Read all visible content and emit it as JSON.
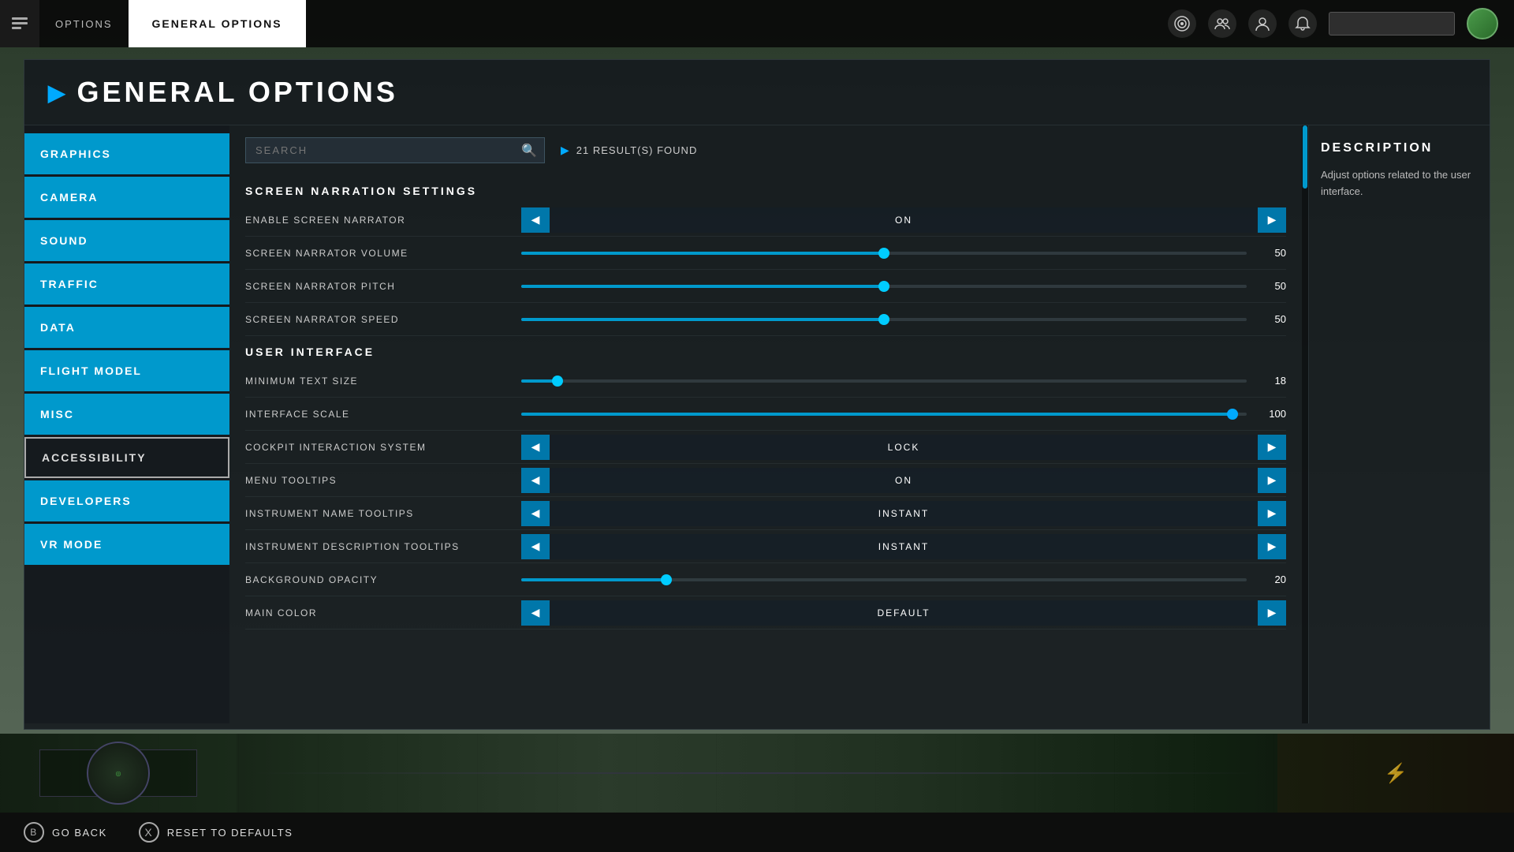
{
  "topbar": {
    "logo_icon": "≡",
    "options_label": "OPTIONS",
    "title_label": "GENERAL OPTIONS",
    "search_placeholder": "",
    "icons": [
      "🎯",
      "👥",
      "👤",
      "🔔"
    ]
  },
  "page": {
    "title": "GENERAL OPTIONS",
    "title_icon": "▶"
  },
  "sidebar": {
    "items": [
      {
        "id": "graphics",
        "label": "GRAPHICS",
        "active": false
      },
      {
        "id": "camera",
        "label": "CAMERA",
        "active": false
      },
      {
        "id": "sound",
        "label": "SOUND",
        "active": false
      },
      {
        "id": "traffic",
        "label": "TRAFFIC",
        "active": false
      },
      {
        "id": "data",
        "label": "DATA",
        "active": false
      },
      {
        "id": "flight-model",
        "label": "FLIGHT MODEL",
        "active": false
      },
      {
        "id": "misc",
        "label": "MISC",
        "active": false
      },
      {
        "id": "accessibility",
        "label": "ACCESSIBILITY",
        "active": true
      },
      {
        "id": "developers",
        "label": "DEVELOPERS",
        "active": false
      },
      {
        "id": "vr-mode",
        "label": "VR MODE",
        "active": false
      }
    ]
  },
  "search": {
    "placeholder": "SEARCH",
    "results_label": "21 RESULT(S) FOUND"
  },
  "sections": [
    {
      "id": "screen-narration",
      "header": "SCREEN NARRATION SETTINGS",
      "settings": [
        {
          "id": "enable-narrator",
          "label": "ENABLE SCREEN NARRATOR",
          "type": "arrow",
          "value": "ON"
        },
        {
          "id": "narrator-volume",
          "label": "SCREEN NARRATOR VOLUME",
          "type": "slider",
          "value": 50,
          "fill_pct": 50
        },
        {
          "id": "narrator-pitch",
          "label": "SCREEN NARRATOR PITCH",
          "type": "slider",
          "value": 50,
          "fill_pct": 50
        },
        {
          "id": "narrator-speed",
          "label": "SCREEN NARRATOR SPEED",
          "type": "slider",
          "value": 50,
          "fill_pct": 50
        }
      ]
    },
    {
      "id": "user-interface",
      "header": "USER INTERFACE",
      "settings": [
        {
          "id": "min-text-size",
          "label": "MINIMUM TEXT SIZE",
          "type": "slider",
          "value": 18,
          "fill_pct": 5
        },
        {
          "id": "interface-scale",
          "label": "INTERFACE SCALE",
          "type": "slider",
          "value": 100,
          "fill_pct": 98
        },
        {
          "id": "cockpit-interaction",
          "label": "COCKPIT INTERACTION SYSTEM",
          "type": "arrow",
          "value": "LOCK"
        },
        {
          "id": "menu-tooltips",
          "label": "MENU TOOLTIPS",
          "type": "arrow",
          "value": "ON"
        },
        {
          "id": "instrument-name-tooltips",
          "label": "INSTRUMENT NAME TOOLTIPS",
          "type": "arrow",
          "value": "INSTANT"
        },
        {
          "id": "instrument-desc-tooltips",
          "label": "INSTRUMENT DESCRIPTION TOOLTIPS",
          "type": "arrow",
          "value": "INSTANT"
        },
        {
          "id": "background-opacity",
          "label": "BACKGROUND OPACITY",
          "type": "slider",
          "value": 20,
          "fill_pct": 20
        },
        {
          "id": "main-color",
          "label": "MAIN COLOR",
          "type": "arrow",
          "value": "DEFAULT"
        }
      ]
    }
  ],
  "description": {
    "title": "DESCRIPTION",
    "text": "Adjust options related to the user interface."
  },
  "bottombar": {
    "go_back_label": "GO BACK",
    "go_back_icon": "B",
    "reset_label": "RESET TO DEFAULTS",
    "reset_icon": "X"
  }
}
